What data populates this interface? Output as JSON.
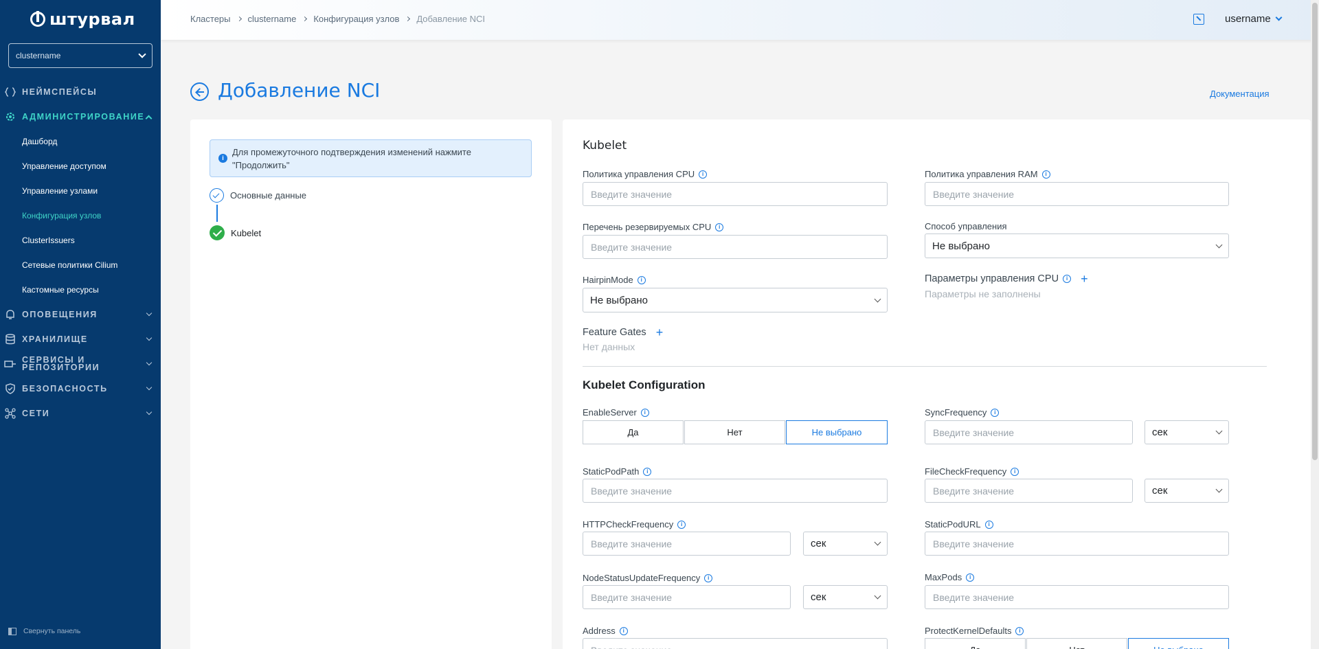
{
  "app": {
    "logo_text": "штурвал"
  },
  "sidebar": {
    "cluster_select": "clustername",
    "sections": [
      {
        "label": "Неймспейсы",
        "icon": "braces-icon",
        "expanded": false,
        "has_arrow": false
      },
      {
        "label": "Администрирование",
        "icon": "gear-icon",
        "expanded": true,
        "has_arrow": true
      },
      {
        "label": "Оповещения",
        "icon": "bell-icon",
        "expanded": false,
        "has_arrow": true
      },
      {
        "label": "Хранилище",
        "icon": "database-icon",
        "expanded": false,
        "has_arrow": true
      },
      {
        "label": "Сервисы и репозитории",
        "label_line1": "Сервисы и",
        "label_line2": "репозитории",
        "icon": "services-icon",
        "expanded": false,
        "has_arrow": true
      },
      {
        "label": "Безопасность",
        "icon": "shield-icon",
        "expanded": false,
        "has_arrow": true
      },
      {
        "label": "Сети",
        "icon": "network-icon",
        "expanded": false,
        "has_arrow": true
      }
    ],
    "admin_items": [
      {
        "label": "Дашборд",
        "active": false
      },
      {
        "label": "Управление доступом",
        "active": false
      },
      {
        "label": "Управление узлами",
        "active": false
      },
      {
        "label": "Конфигурация узлов",
        "active": true
      },
      {
        "label": "ClusterIssuers",
        "active": false
      },
      {
        "label": "Сетевые политики Cilium",
        "active": false
      },
      {
        "label": "Кастомные ресурсы",
        "active": false
      }
    ],
    "collapse_label": "Свернуть панель"
  },
  "header": {
    "breadcrumbs": [
      "Кластеры",
      "clustername",
      "Конфигурация узлов",
      "Добавление NCI"
    ],
    "username": "username"
  },
  "page": {
    "title": "Добавление NCI",
    "doc_link": "Документация"
  },
  "wizard": {
    "info_text": "Для промежуточного подтверждения изменений нажмите \"Продолжить\"",
    "steps": [
      {
        "label": "Основные данные",
        "state": "done"
      },
      {
        "label": "Kubelet",
        "state": "current"
      }
    ]
  },
  "form": {
    "placeholder": "Введите значение",
    "not_selected": "Не выбрано",
    "unit_sec": "сек",
    "kubelet": {
      "title": "Kubelet",
      "cpu_policy": "Политика управления CPU",
      "ram_policy": "Политика управления RAM",
      "reserved_cpus": "Перечень резервируемых CPU",
      "management_mode": "Способ управления",
      "hairpin_mode": "HairpinMode",
      "cpu_params": "Параметры управления CPU",
      "cpu_params_empty": "Параметры не заполнены",
      "feature_gates": "Feature Gates",
      "feature_gates_empty": "Нет данных"
    },
    "kubelet_config": {
      "title": "Kubelet Configuration",
      "enable_server": "EnableServer",
      "yes": "Да",
      "no": "Нет",
      "sync_frequency": "SyncFrequency",
      "static_pod_path": "StaticPodPath",
      "file_check_frequency": "FileCheckFrequency",
      "http_check_frequency": "HTTPCheckFrequency",
      "static_pod_url": "StaticPodURL",
      "node_status_update_frequency": "NodeStatusUpdateFrequency",
      "max_pods": "MaxPods",
      "address": "Address",
      "protect_kernel_defaults": "ProtectKernelDefaults"
    }
  },
  "colors": {
    "sidebar_bg": "#063a6e",
    "accent": "#1a7ae0",
    "active_nav": "#3fd5c8",
    "success": "#2fae4a"
  }
}
